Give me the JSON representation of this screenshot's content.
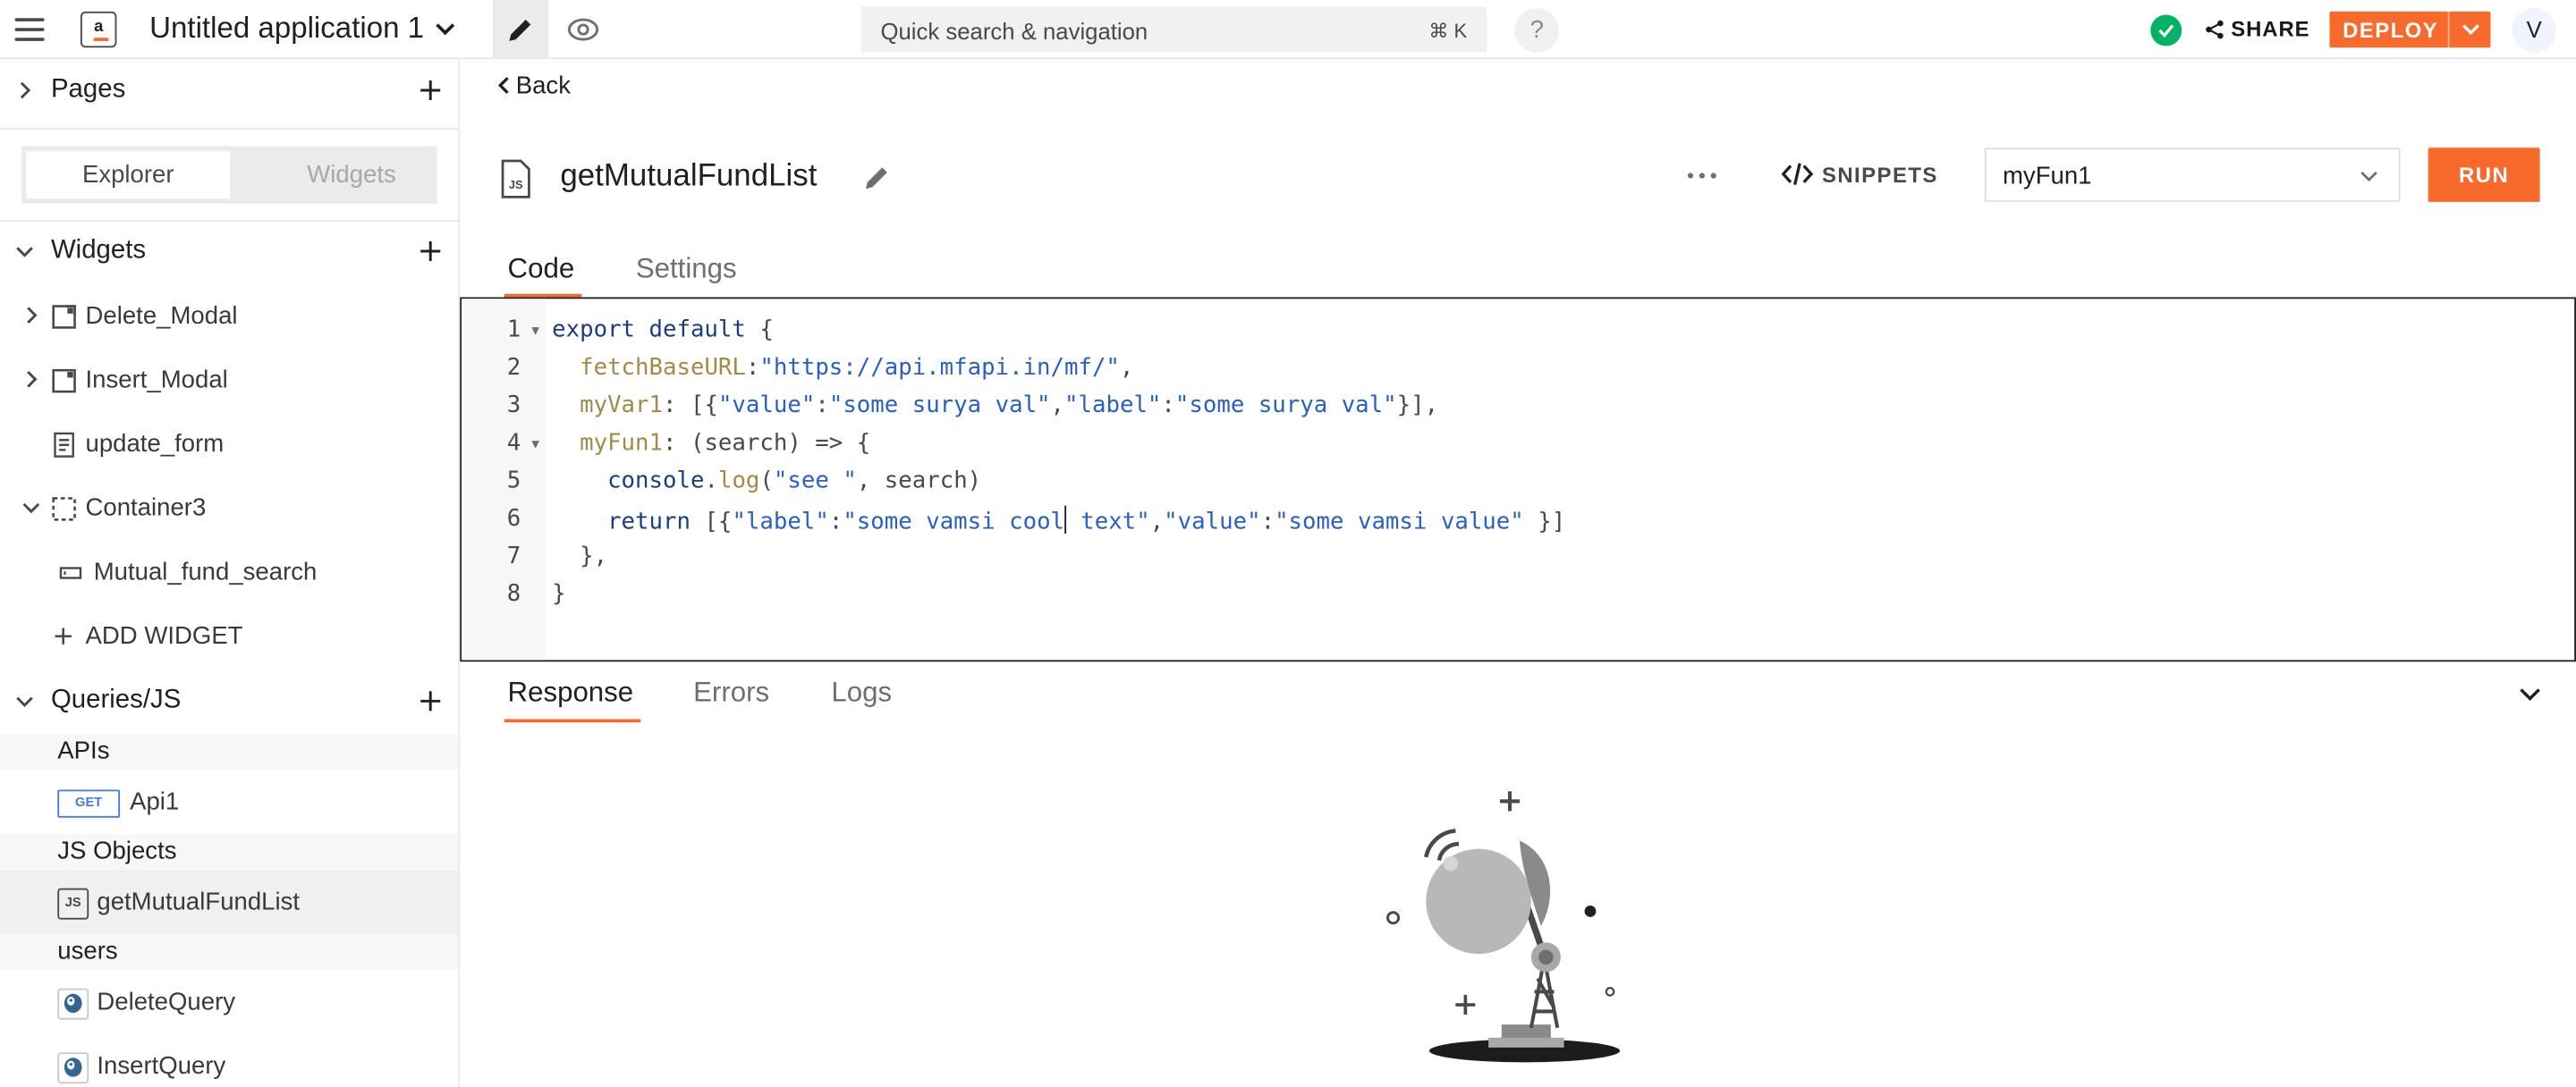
{
  "app": {
    "title": "Untitled application 1",
    "logo_text": "a",
    "search_placeholder": "Quick search & navigation",
    "search_shortcut": "⌘ K",
    "help": "?",
    "share_label": "SHARE",
    "deploy_label": "DEPLOY",
    "avatar_initial": "V",
    "accent_color": "#f86a2b"
  },
  "sidebar": {
    "pages_label": "Pages",
    "tabs": [
      "Explorer",
      "Widgets"
    ],
    "widgets_label": "Widgets",
    "widgets": [
      {
        "name": "Delete_Modal",
        "icon": "modal-icon"
      },
      {
        "name": "Insert_Modal",
        "icon": "modal-icon"
      },
      {
        "name": "update_form",
        "icon": "form-icon"
      },
      {
        "name": "Container3",
        "icon": "container-icon"
      },
      {
        "name": "Mutual_fund_search",
        "icon": "input-icon"
      }
    ],
    "add_widget_label": "ADD WIDGET",
    "queries_label": "Queries/JS",
    "groups": {
      "apis": "APIs",
      "js_objects": "JS Objects",
      "users": "users"
    },
    "api_items": [
      {
        "method": "GET",
        "name": "Api1"
      }
    ],
    "js_items": [
      {
        "name": "getMutualFundList",
        "badge": "JS"
      }
    ],
    "query_items": [
      {
        "name": "DeleteQuery"
      },
      {
        "name": "InsertQuery"
      }
    ]
  },
  "editor": {
    "back_label": "Back",
    "file_badge": "JS",
    "object_name": "getMutualFundList",
    "snippets_label": "SNIPPETS",
    "selected_function": "myFun1",
    "run_label": "RUN",
    "tabs": [
      "Code",
      "Settings"
    ],
    "line_numbers": [
      "1",
      "2",
      "3",
      "4",
      "5",
      "6",
      "7",
      "8"
    ],
    "code": {
      "l1a": "export default",
      "l1b": " {",
      "l2a": "fetchBaseURL",
      "l2b": ":",
      "l2c": "\"https://api.mfapi.in/mf/\"",
      "l2d": ",",
      "l3a": "myVar1",
      "l3b": ": [{",
      "l3c": "\"value\"",
      "l3d": ":",
      "l3e": "\"some surya val\"",
      "l3f": ",",
      "l3g": "\"label\"",
      "l3h": ":",
      "l3i": "\"some surya val\"",
      "l3j": "}],",
      "l4a": "myFun1",
      "l4b": ": (search) => {",
      "l5a": "console",
      "l5b": ".",
      "l5c": "log",
      "l5d": "(",
      "l5e": "\"see \"",
      "l5f": ", search)",
      "l6a": "return",
      "l6b": " [{",
      "l6c": "\"label\"",
      "l6d": ":",
      "l6e": "\"some vamsi cool",
      "l6f": " text\"",
      "l6g": ",",
      "l6h": "\"value\"",
      "l6i": ":",
      "l6j": "\"some vamsi value\"",
      "l6k": " }]",
      "l7": "},",
      "l8": "}"
    }
  },
  "response": {
    "tabs": [
      "Response",
      "Errors",
      "Logs"
    ]
  }
}
